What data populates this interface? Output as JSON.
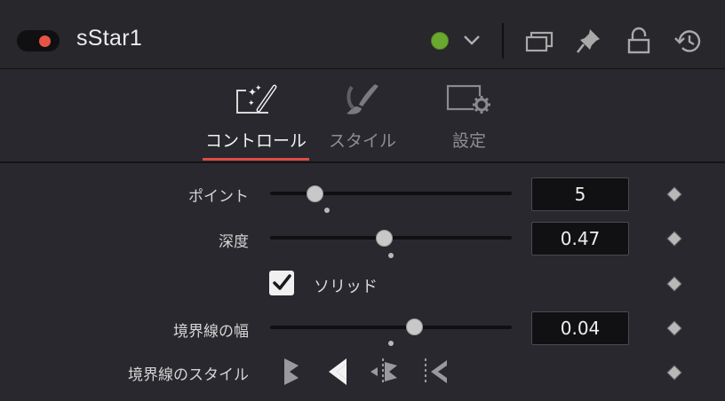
{
  "header": {
    "title": "sStar1",
    "toggle_state": "on",
    "color_indicator": "#6aa92f",
    "icons": [
      "chevron-down-icon",
      "window-icon",
      "pin-icon",
      "lock-icon",
      "reset-icon"
    ]
  },
  "tabs": [
    {
      "label": "コントロール",
      "icon": "magic-wand-icon",
      "active": true
    },
    {
      "label": "スタイル",
      "icon": "brush-icon",
      "active": false
    },
    {
      "label": "設定",
      "icon": "settings-icon",
      "active": false
    }
  ],
  "controls": {
    "points": {
      "label": "ポイント",
      "value": "5",
      "slider_fraction": 0.19
    },
    "depth": {
      "label": "深度",
      "value": "0.47",
      "slider_fraction": 0.47
    },
    "solid": {
      "label": "ソリッド",
      "checked": true
    },
    "border_width": {
      "label": "境界線の幅",
      "value": "0.04",
      "slider_fraction": 0.6
    },
    "border_style": {
      "label": "境界線のスタイル",
      "selected_index": 1,
      "options": [
        "border-inside-icon",
        "border-center-icon",
        "border-outside-icon",
        "border-dashed-icon"
      ]
    }
  },
  "colors": {
    "accent": "#e04a45",
    "toggle_dot": "#e65446"
  }
}
